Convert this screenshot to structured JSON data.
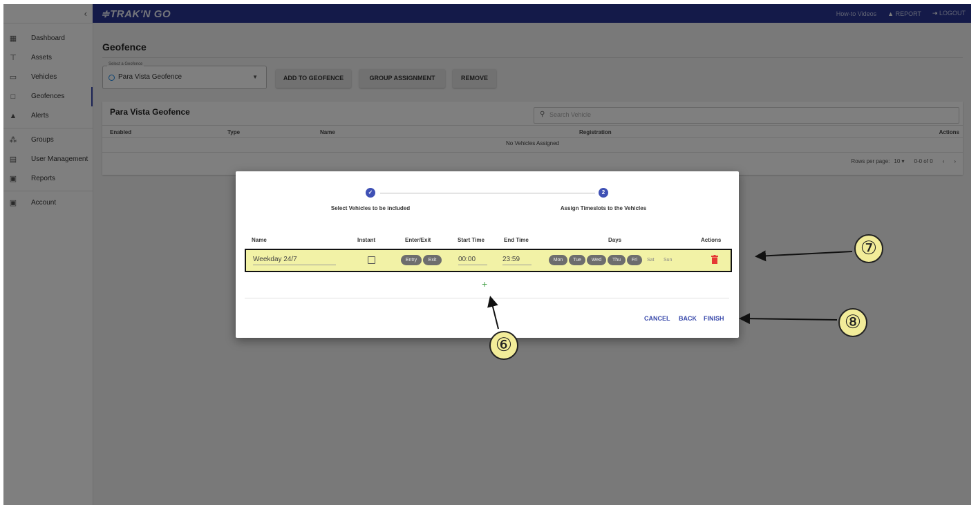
{
  "topbar": {
    "logo": "≑TRAK'N GO",
    "how_to": "How-to Videos",
    "report": "REPORT",
    "logout": "LOGOUT"
  },
  "sidebar": {
    "collapse_icon": "chevron-left-icon",
    "items": [
      {
        "label": "Dashboard",
        "icon": "dashboard-icon",
        "glyph": "▦"
      },
      {
        "label": "Assets",
        "icon": "tracker-icon",
        "glyph": "⊤"
      },
      {
        "label": "Vehicles",
        "icon": "car-icon",
        "glyph": "▭"
      },
      {
        "label": "Geofences",
        "icon": "square-outline-icon",
        "glyph": "□"
      },
      {
        "label": "Alerts",
        "icon": "warning-icon",
        "glyph": "▲"
      },
      {
        "label": "Groups",
        "icon": "groups-icon",
        "glyph": "⁂"
      },
      {
        "label": "User Management",
        "icon": "badge-icon",
        "glyph": "▤"
      },
      {
        "label": "Reports",
        "icon": "clipboard-icon",
        "glyph": "▣"
      },
      {
        "label": "Account",
        "icon": "account-box-icon",
        "glyph": "▣"
      }
    ]
  },
  "page": {
    "title": "Geofence",
    "select_label": "Select a Geofence",
    "select_value": "Para Vista Geofence",
    "buttons": {
      "add": "ADD TO GEOFENCE",
      "group": "GROUP ASSIGNMENT",
      "remove": "REMOVE"
    }
  },
  "table": {
    "title": "Para Vista Geofence",
    "search_placeholder": "Search Vehicle",
    "columns": [
      "Enabled",
      "Type",
      "Name",
      "Registration",
      "Actions"
    ],
    "empty_text": "No Vehicles Assigned",
    "rows_per_page_label": "Rows per page:",
    "rows_per_page": "10 ▾",
    "range": "0-0 of 0",
    "prev": "‹",
    "next": "›"
  },
  "modal": {
    "step1_icon": "✓",
    "step1_label": "Select Vehicles to be included",
    "step2_number": "2",
    "step2_label": "Assign Timeslots to the Vehicles",
    "columns": {
      "name": "Name",
      "instant": "Instant",
      "enter_exit": "Enter/Exit",
      "start": "Start Time",
      "end": "End Time",
      "days": "Days",
      "actions": "Actions"
    },
    "row": {
      "name": "Weekday 24/7",
      "entry": "Entry",
      "exit": "Exit",
      "start": "00:00",
      "end": "23:59",
      "days_on": [
        "Mon",
        "Tue",
        "Wed",
        "Thu",
        "Fri"
      ],
      "days_off": [
        "Sat",
        "Sun"
      ]
    },
    "add": "+",
    "actions": {
      "cancel": "CANCEL",
      "back": "BACK",
      "finish": "FINISH"
    }
  },
  "annotations": {
    "callout_6": "⑥",
    "callout_7": "⑦",
    "callout_8": "⑧"
  },
  "colors": {
    "topbar": "#283593",
    "accent": "#3f51b5",
    "highlight": "#f2f2a6",
    "delete": "#e53935",
    "add": "#43a047"
  }
}
